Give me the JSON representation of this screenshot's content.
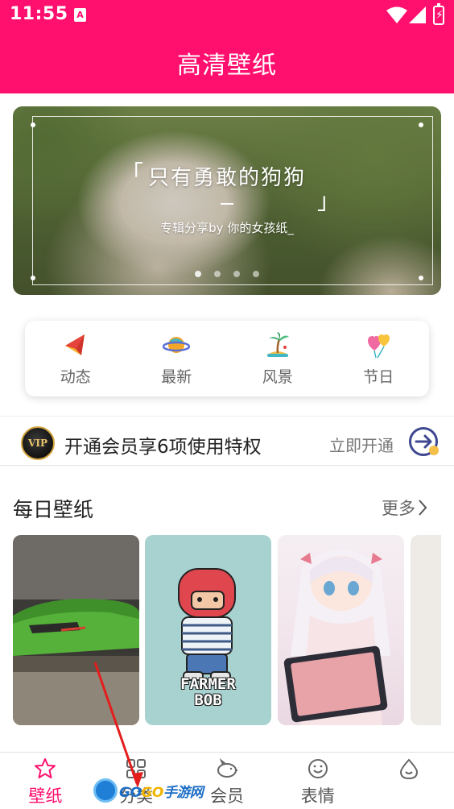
{
  "status_bar": {
    "time": "11:55",
    "notification_badge": "A"
  },
  "header": {
    "title": "高清壁纸",
    "background_color": "#ff0f6e"
  },
  "banner": {
    "title": "只有勇敢的狗狗",
    "subtitle": "专辑分享by 你的女孩纸_",
    "slide_count": 4,
    "active_slide": 1
  },
  "categories": [
    {
      "label": "动态",
      "icon": "kite-icon"
    },
    {
      "label": "最新",
      "icon": "planet-icon"
    },
    {
      "label": "风景",
      "icon": "palm-tree-icon"
    },
    {
      "label": "节日",
      "icon": "balloon-heart-icon"
    }
  ],
  "vip": {
    "badge": "VIP",
    "text": "开通会员享6项使用特权",
    "action": "立即开通"
  },
  "daily": {
    "title": "每日壁纸",
    "more": "更多",
    "thumb_bob_text_1": "FARMER",
    "thumb_bob_text_2": "BOB"
  },
  "bottom_nav": [
    {
      "label": "壁纸",
      "icon": "star-icon",
      "active": true
    },
    {
      "label": "分类",
      "icon": "grid-icon",
      "active": false
    },
    {
      "label": "会员",
      "icon": "piggy-bank-icon",
      "active": false
    },
    {
      "label": "表情",
      "icon": "smiley-icon",
      "active": false
    },
    {
      "label": "",
      "icon": "drop-face-icon",
      "active": false
    }
  ],
  "watermark": {
    "brand_1": "GO",
    "brand_2": "GO",
    "brand_3": "手游网"
  }
}
